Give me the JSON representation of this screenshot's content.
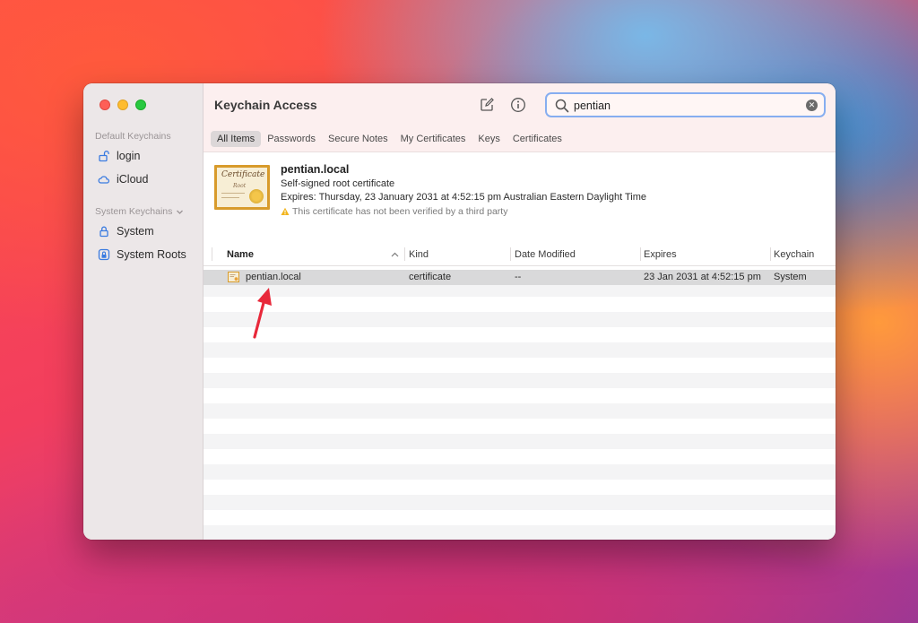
{
  "window": {
    "title": "Keychain Access"
  },
  "sidebar": {
    "default_section": "Default Keychains",
    "system_section": "System Keychains",
    "items": [
      {
        "label": "login",
        "icon": "lock-open-icon"
      },
      {
        "label": "iCloud",
        "icon": "cloud-icon"
      },
      {
        "label": "System",
        "icon": "lock-icon"
      },
      {
        "label": "System Roots",
        "icon": "lock-box-icon"
      }
    ]
  },
  "search": {
    "value": "pentian"
  },
  "tabs": [
    {
      "label": "All Items",
      "active": true
    },
    {
      "label": "Passwords",
      "active": false
    },
    {
      "label": "Secure Notes",
      "active": false
    },
    {
      "label": "My Certificates",
      "active": false
    },
    {
      "label": "Keys",
      "active": false
    },
    {
      "label": "Certificates",
      "active": false
    }
  ],
  "detail": {
    "thumb_title": "Certificate",
    "thumb_sub": "Root",
    "name": "pentian.local",
    "subtitle": "Self-signed root certificate",
    "expires": "Expires: Thursday, 23 January 2031 at 4:52:15 pm Australian Eastern Daylight Time",
    "warning": "This certificate has not been verified by a third party"
  },
  "table": {
    "columns": [
      "Name",
      "Kind",
      "Date Modified",
      "Expires",
      "Keychain"
    ],
    "rows": [
      {
        "name": "pentian.local",
        "kind": "certificate",
        "date_modified": "--",
        "expires": "23 Jan 2031 at 4:52:15 pm",
        "keychain": "System"
      }
    ]
  },
  "colors": {
    "accent": "#86aef0",
    "annotation_arrow": "#e8283a",
    "titlebar": "#fcefef",
    "sidebar": "#ece7e8"
  }
}
